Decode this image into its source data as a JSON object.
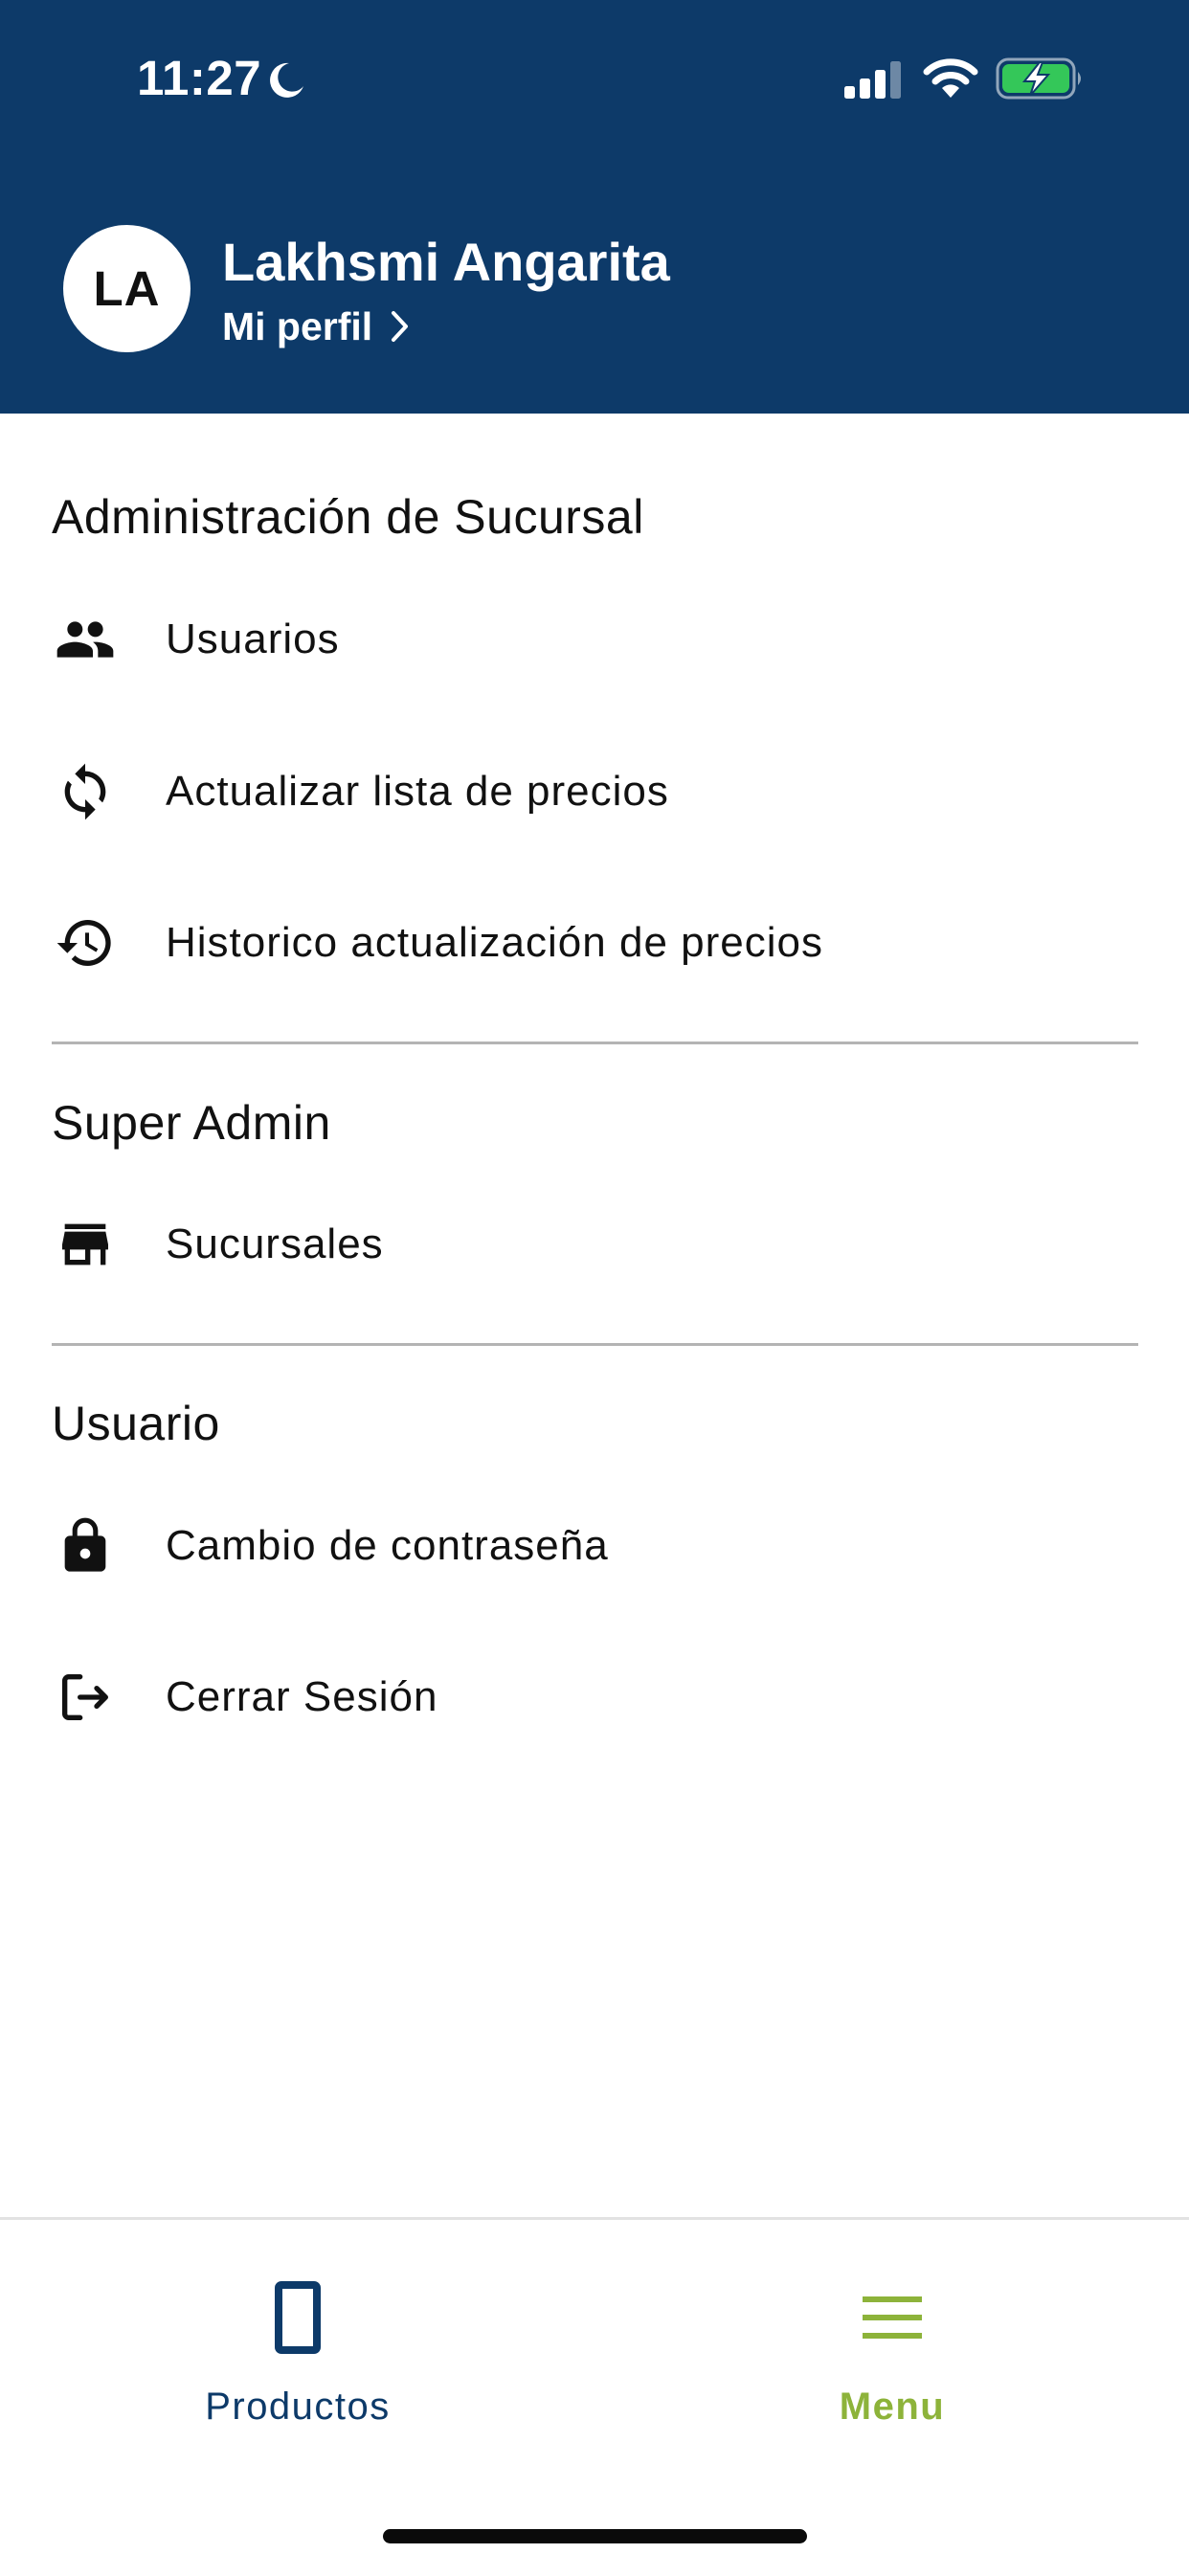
{
  "status_bar": {
    "time": "11:27"
  },
  "header": {
    "avatar_initials": "LA",
    "user_name": "Lakhsmi Angarita",
    "profile_link": "Mi perfil"
  },
  "sections": [
    {
      "title": "Administración de Sucursal",
      "items": [
        {
          "label": "Usuarios",
          "icon": "people-icon"
        },
        {
          "label": "Actualizar lista de precios",
          "icon": "sync-icon"
        },
        {
          "label": "Historico actualización de precios",
          "icon": "history-icon"
        }
      ]
    },
    {
      "title": "Super Admin",
      "items": [
        {
          "label": "Sucursales",
          "icon": "store-icon"
        }
      ]
    },
    {
      "title": "Usuario",
      "items": [
        {
          "label": "Cambio de contraseña",
          "icon": "lock-icon"
        },
        {
          "label": "Cerrar Sesión",
          "icon": "logout-icon"
        }
      ]
    }
  ],
  "bottom_nav": {
    "items": [
      {
        "label": "Productos",
        "icon": "phone-device-icon",
        "active": false
      },
      {
        "label": "Menu",
        "icon": "hamburger-menu-icon",
        "active": true
      }
    ]
  },
  "colors": {
    "header_bg": "#0d3a69",
    "active_tab": "#8db33a",
    "inactive_tab": "#0d3a69",
    "battery_fill": "#34c759"
  }
}
